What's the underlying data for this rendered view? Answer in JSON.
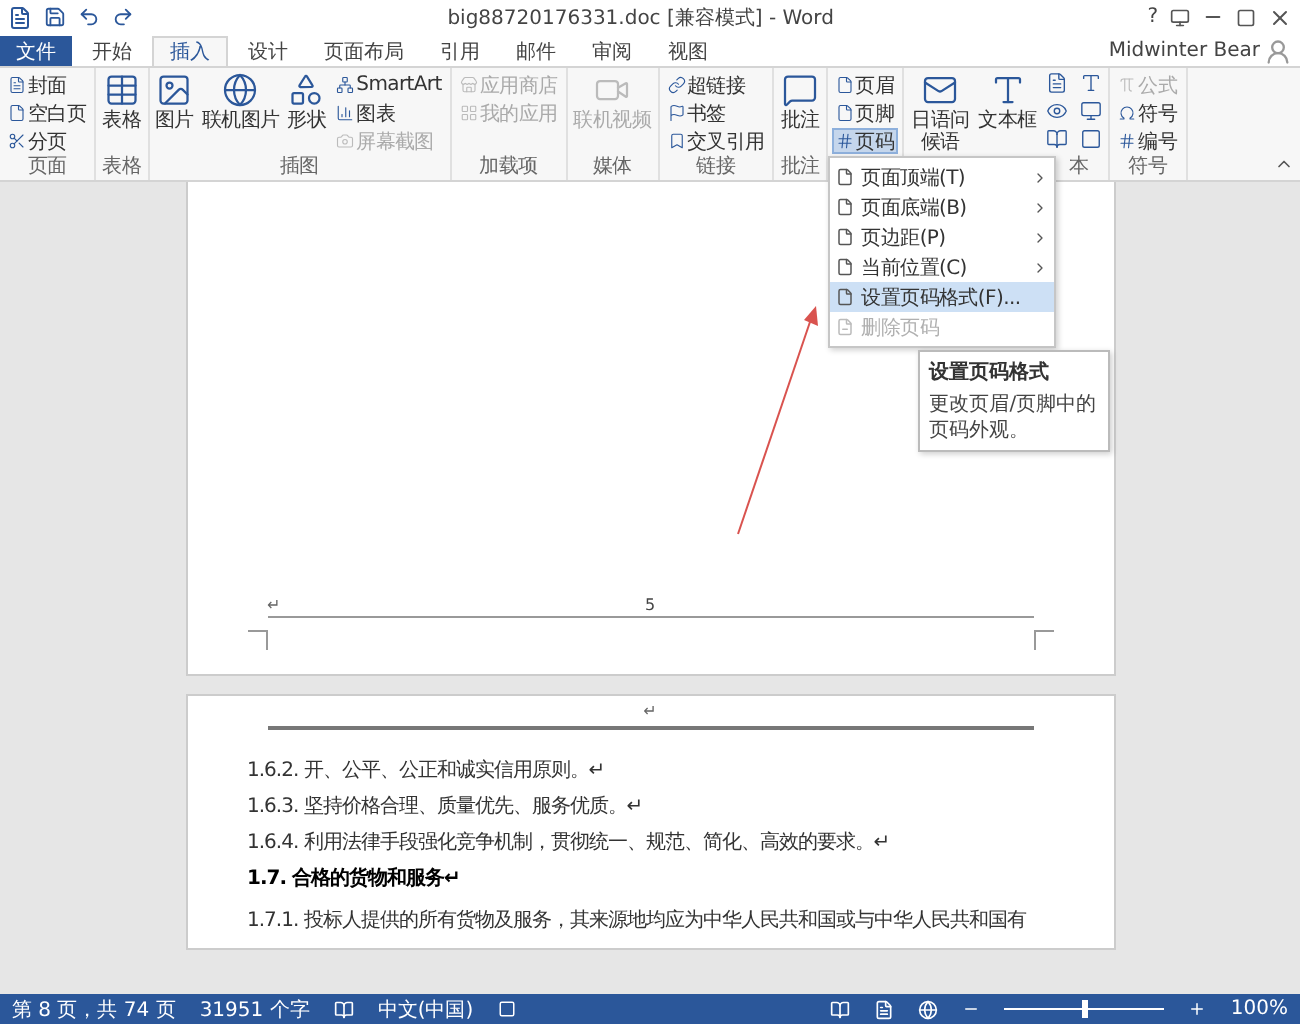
{
  "window": {
    "title": "big88720176331.doc [兼容模式] - Word",
    "help": "?",
    "user": "Midwinter Bear"
  },
  "tabs": [
    {
      "label": "文件",
      "kind": "file",
      "selected": false
    },
    {
      "label": "开始",
      "kind": "tab",
      "selected": false
    },
    {
      "label": "插入",
      "kind": "tab",
      "selected": true
    },
    {
      "label": "设计",
      "kind": "tab",
      "selected": false
    },
    {
      "label": "页面布局",
      "kind": "tab",
      "selected": false
    },
    {
      "label": "引用",
      "kind": "tab",
      "selected": false
    },
    {
      "label": "邮件",
      "kind": "tab",
      "selected": false
    },
    {
      "label": "审阅",
      "kind": "tab",
      "selected": false
    },
    {
      "label": "视图",
      "kind": "tab",
      "selected": false
    }
  ],
  "ribbon": {
    "groups": [
      {
        "label": "页面",
        "items": [
          {
            "label": "封面",
            "kind": "small",
            "disabled": false,
            "selected": false
          },
          {
            "label": "空白页",
            "kind": "small",
            "disabled": false,
            "selected": false
          },
          {
            "label": "分页",
            "kind": "small",
            "disabled": false,
            "selected": false
          }
        ]
      },
      {
        "label": "表格",
        "items": [
          {
            "label": "表格",
            "kind": "large",
            "disabled": false,
            "selected": false
          }
        ]
      },
      {
        "label": "插图",
        "items": [
          {
            "label": "图片",
            "kind": "large",
            "disabled": false,
            "selected": false
          },
          {
            "label": "联机图片",
            "kind": "large",
            "disabled": false,
            "selected": false
          },
          {
            "label": "形状",
            "kind": "large",
            "disabled": false,
            "selected": false
          },
          {
            "label": "SmartArt",
            "kind": "small",
            "disabled": false,
            "selected": false
          },
          {
            "label": "图表",
            "kind": "small",
            "disabled": false,
            "selected": false
          },
          {
            "label": "屏幕截图",
            "kind": "small",
            "disabled": true,
            "selected": false
          }
        ]
      },
      {
        "label": "加载项",
        "items": [
          {
            "label": "应用商店",
            "kind": "small",
            "disabled": true,
            "selected": false
          },
          {
            "label": "我的应用",
            "kind": "small",
            "disabled": true,
            "selected": false
          }
        ]
      },
      {
        "label": "媒体",
        "items": [
          {
            "label": "联机视频",
            "kind": "large",
            "disabled": true,
            "selected": false
          }
        ]
      },
      {
        "label": "链接",
        "items": [
          {
            "label": "超链接",
            "kind": "small",
            "disabled": false,
            "selected": false
          },
          {
            "label": "书签",
            "kind": "small",
            "disabled": false,
            "selected": false
          },
          {
            "label": "交叉引用",
            "kind": "small",
            "disabled": false,
            "selected": false
          }
        ]
      },
      {
        "label": "批注",
        "items": [
          {
            "label": "批注",
            "kind": "large",
            "disabled": false,
            "selected": false
          }
        ]
      },
      {
        "items": [
          {
            "label": "页眉",
            "kind": "small",
            "disabled": false,
            "selected": false
          },
          {
            "label": "页脚",
            "kind": "small",
            "disabled": false,
            "selected": false
          },
          {
            "label": "页码",
            "kind": "small",
            "disabled": false,
            "selected": true
          }
        ]
      },
      {
        "label": "本",
        "items": [
          {
            "label": "日语问候语",
            "kind": "large",
            "disabled": false,
            "selected": false
          },
          {
            "label": "文本框",
            "kind": "large",
            "disabled": false,
            "selected": false
          },
          {
            "kind": "icons",
            "disabled": false
          }
        ]
      },
      {
        "label": "符号",
        "items": [
          {
            "label": "公式",
            "kind": "small",
            "disabled": true,
            "selected": false
          },
          {
            "label": "符号",
            "kind": "small",
            "disabled": false,
            "selected": false
          },
          {
            "label": "编号",
            "kind": "small",
            "disabled": false,
            "selected": false
          }
        ]
      }
    ]
  },
  "menu": {
    "items": [
      {
        "label": "页面顶端(T)",
        "submenu": true,
        "disabled": false,
        "selected": false
      },
      {
        "label": "页面底端(B)",
        "submenu": true,
        "disabled": false,
        "selected": false
      },
      {
        "label": "页边距(P)",
        "submenu": true,
        "disabled": false,
        "selected": false
      },
      {
        "label": "当前位置(C)",
        "submenu": true,
        "disabled": false,
        "selected": false
      },
      {
        "label": "设置页码格式(F)...",
        "submenu": false,
        "disabled": false,
        "selected": true
      },
      {
        "label": "删除页码",
        "submenu": false,
        "disabled": true,
        "selected": false
      }
    ]
  },
  "tooltip": {
    "title": "设置页码格式",
    "body": "更改页眉/页脚中的页码外观。"
  },
  "document": {
    "footer_mark": "↵",
    "page_number": "5",
    "header_mark": "↵",
    "paragraphs": [
      {
        "text": "1.6.2. 开、公平、公正和诚实信用原则。↵",
        "kind": "body"
      },
      {
        "text": "1.6.3. 坚持价格合理、质量优先、服务优质。↵",
        "kind": "body"
      },
      {
        "text": "1.6.4. 利用法律手段强化竞争机制，贯彻统一、规范、简化、高效的要求。↵",
        "kind": "body"
      },
      {
        "text": "1.7. 合格的货物和服务↵",
        "kind": "heading"
      },
      {
        "text": "1.7.1. 投标人提供的所有货物及服务，其来源地均应为中华人民共和国或与中华人民共和国有",
        "kind": "body"
      }
    ]
  },
  "status_bar": {
    "page": "第 8 页，共 74 页",
    "words": "31951 个字",
    "language": "中文(中国)",
    "zoom": "100%",
    "zoom_slider": {
      "level": 0.5
    }
  }
}
